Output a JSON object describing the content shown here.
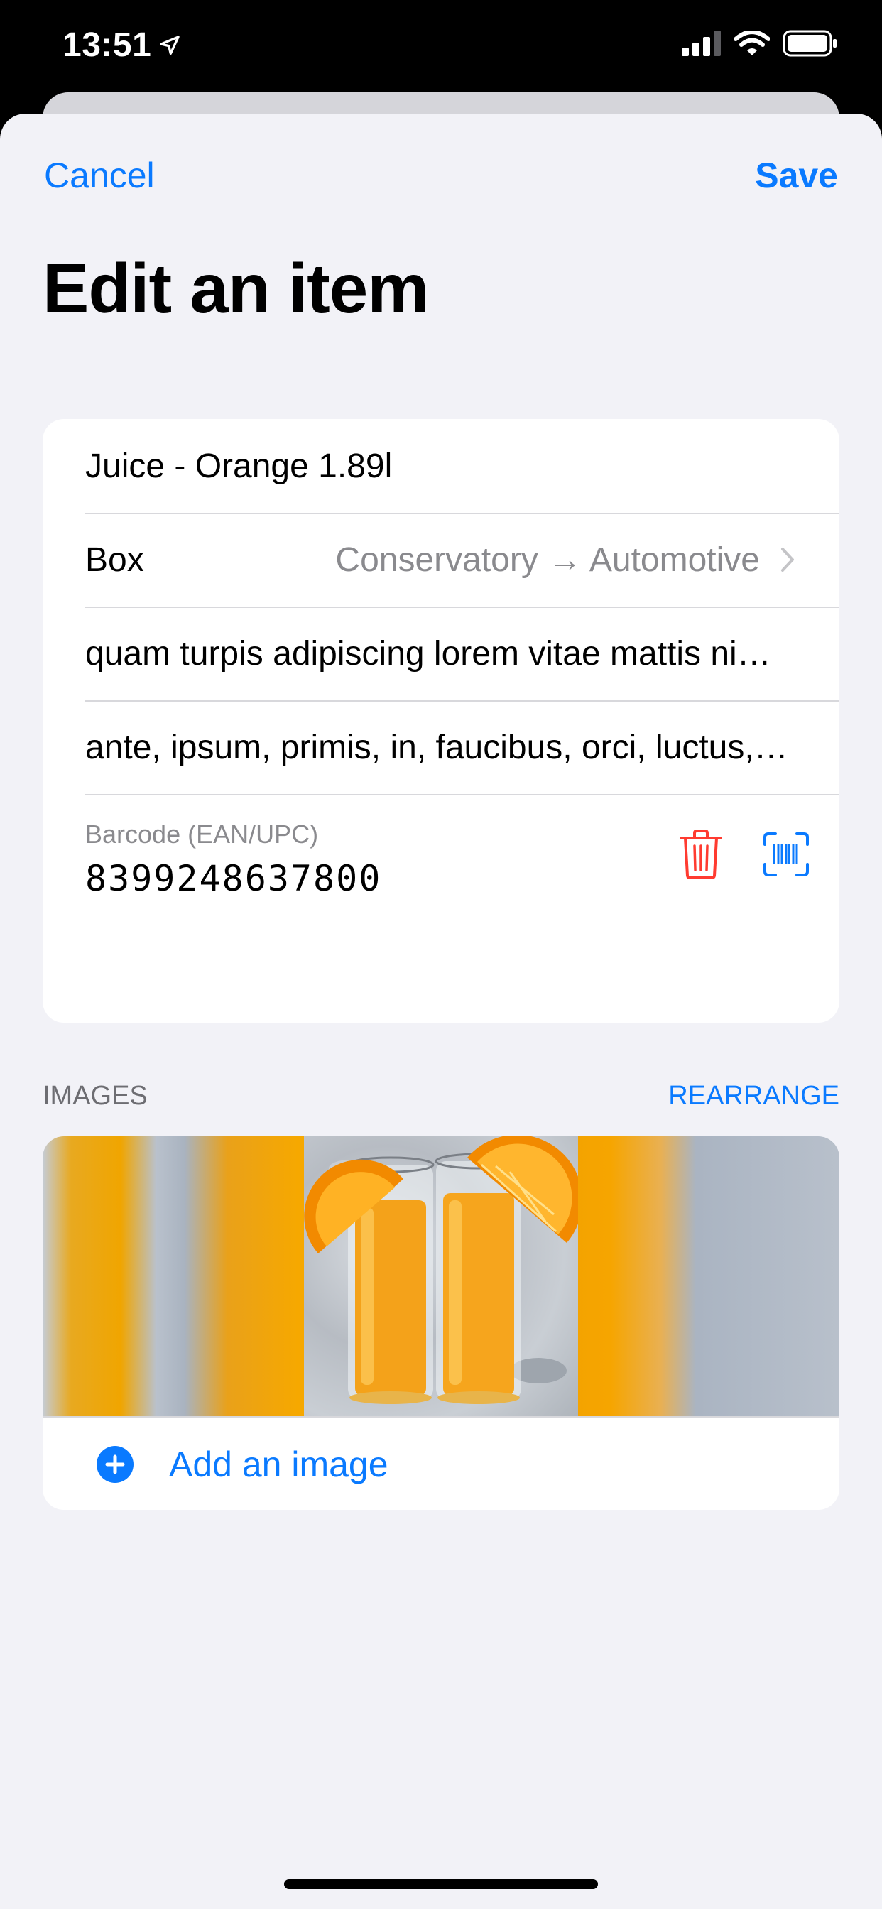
{
  "status": {
    "time": "13:51",
    "icons": [
      "location-arrow-icon",
      "cellular-signal-icon",
      "wifi-icon",
      "battery-icon"
    ]
  },
  "nav": {
    "cancel_label": "Cancel",
    "save_label": "Save",
    "title": "Edit an item"
  },
  "form": {
    "name": "Juice - Orange 1.89l",
    "box_label": "Box",
    "box_value": "Conservatory → Automotive",
    "description": "quam turpis adipiscing lorem vitae mattis nibh ligula nec sem duis aliquam",
    "tags": "ante, ipsum, primis, in, faucibus, orci, luctus, et, ultrices",
    "barcode_label": "Barcode (EAN/UPC)",
    "barcode_value": "8399248637800"
  },
  "images": {
    "section_title": "IMAGES",
    "rearrange_label": "REARRANGE",
    "add_label": "Add an image"
  },
  "colors": {
    "accent": "#0a7aff",
    "destructive": "#ff3b30",
    "background": "#f2f2f7"
  }
}
